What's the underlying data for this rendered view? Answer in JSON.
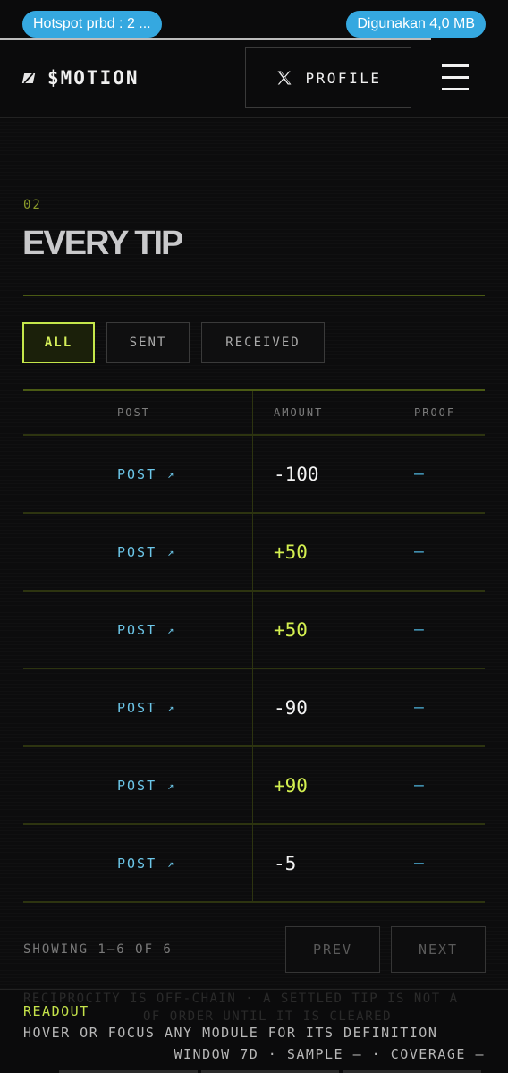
{
  "status_bar": {
    "hotspot_label": "Hotspot prbd : 2 ...",
    "data_usage_label": "Digunakan 4,0 MB"
  },
  "header": {
    "logo_text": "$MOTION",
    "profile_label": "PROFILE",
    "x_icon": "x-logo-icon",
    "menu_icon": "hamburger-menu-icon"
  },
  "section": {
    "number": "02",
    "title": "EVERY TIP"
  },
  "filters": [
    {
      "label": "ALL",
      "active": true
    },
    {
      "label": "SENT",
      "active": false
    },
    {
      "label": "RECEIVED",
      "active": false
    }
  ],
  "table": {
    "columns": [
      "",
      "POST",
      "AMOUNT",
      "PROOF"
    ],
    "rows": [
      {
        "post": "POST",
        "arrow": "↗",
        "amount": "-100",
        "positive": false,
        "proof": "—"
      },
      {
        "post": "POST",
        "arrow": "↗",
        "amount": "+50",
        "positive": true,
        "proof": "—"
      },
      {
        "post": "POST",
        "arrow": "↗",
        "amount": "+50",
        "positive": true,
        "proof": "—"
      },
      {
        "post": "POST",
        "arrow": "↗",
        "amount": "-90",
        "positive": false,
        "proof": "—"
      },
      {
        "post": "POST",
        "arrow": "↗",
        "amount": "+90",
        "positive": true,
        "proof": "—"
      },
      {
        "post": "POST",
        "arrow": "↗",
        "amount": "-5",
        "positive": false,
        "proof": "—"
      }
    ]
  },
  "pagination": {
    "showing": "SHOWING 1–6 OF 6",
    "prev_label": "PREV",
    "next_label": "NEXT"
  },
  "readout": {
    "ghost_line_1": "RECIPROCITY IS OFF-CHAIN · A SETTLED TIP IS NOT A",
    "ghost_line_2": "OF ORDER UNTIL IT IS CLEARED",
    "label": "READOUT",
    "hint": "HOVER OR FOCUS ANY MODULE FOR ITS DEFINITION",
    "meta": "WINDOW 7D · SAMPLE — · COVERAGE —"
  },
  "colors": {
    "accent": "#c4e64b",
    "positive": "#d3ef50",
    "link": "#6cc6e8",
    "background": "#0b0b0c",
    "status_pill": "#35a8e0"
  }
}
